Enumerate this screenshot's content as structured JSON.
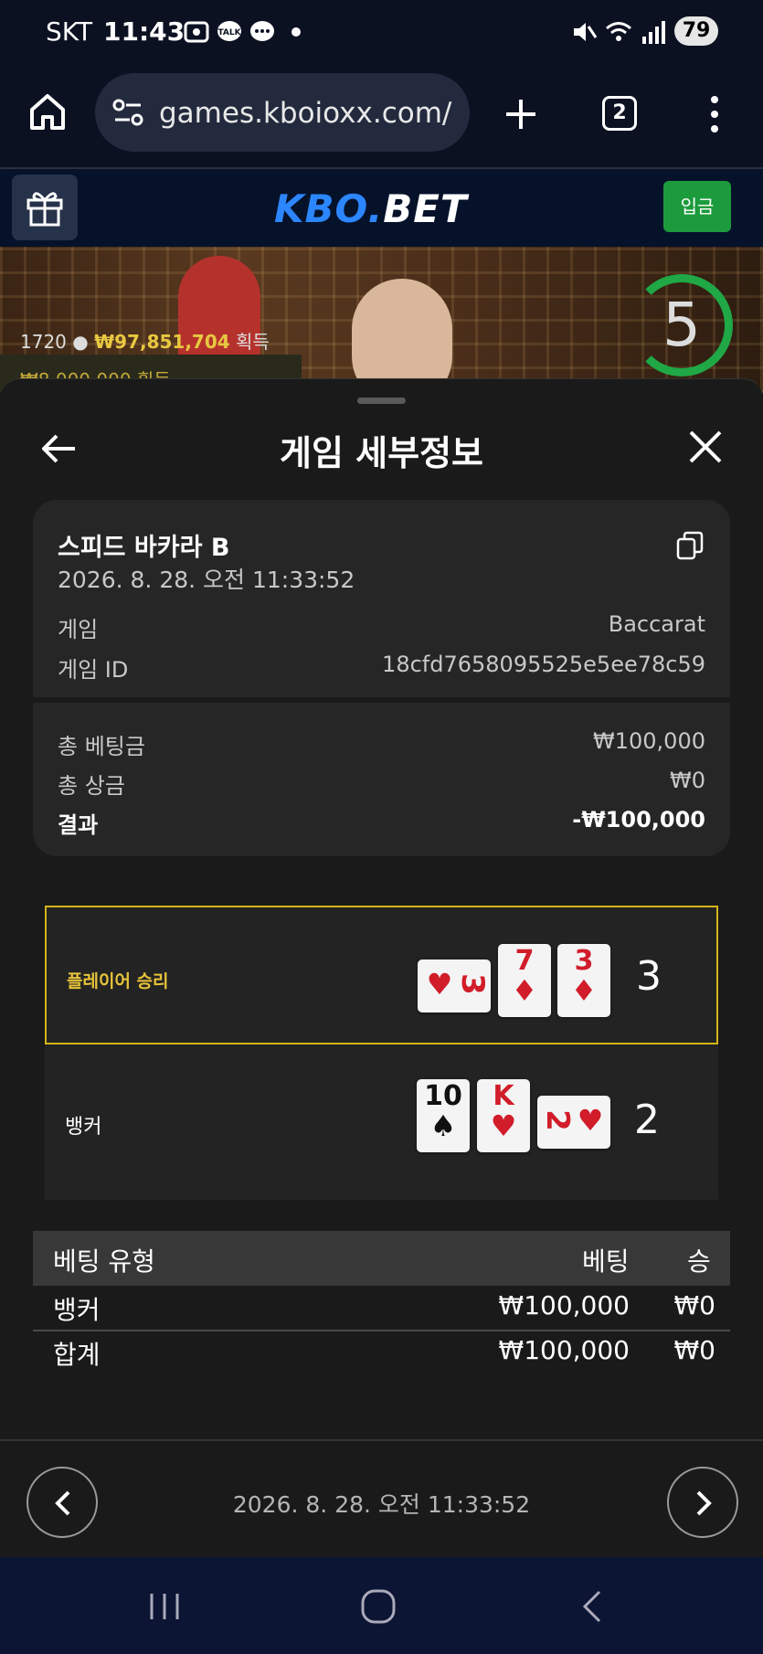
{
  "status_bar": {
    "carrier": "SKT",
    "time": "11:43",
    "battery": "79"
  },
  "browser": {
    "url": "games.kboioxx.com/",
    "tab_count": "2"
  },
  "site": {
    "logo_part1": "KBO.",
    "logo_part2": "BET",
    "deposit_label": "입금"
  },
  "banner": {
    "players": "1720",
    "winnings": "₩97,851,704",
    "winnings_suffix": "획득",
    "second_line": "₩8,000,000 획득",
    "countdown": "5"
  },
  "sheet": {
    "title": "게임 세부정보",
    "game_name": "스피드 바카라 B",
    "game_datetime": "2026. 8. 28. 오전 11:33:52",
    "rows": [
      {
        "label": "게임",
        "value": "Baccarat"
      },
      {
        "label": "게임 ID",
        "value": "18cfd7658095525e5ee78c59"
      }
    ],
    "totals": [
      {
        "label": "총 베팅금",
        "value": "₩100,000"
      },
      {
        "label": "총 상금",
        "value": "₩0"
      },
      {
        "label": "결과",
        "value": "-₩100,000"
      }
    ]
  },
  "result": {
    "player": {
      "label": "플레이어 승리",
      "score": "3",
      "cards": [
        {
          "rank": "3",
          "suit": "♥",
          "color": "red",
          "orientation": "sideways"
        },
        {
          "rank": "7",
          "suit": "♦",
          "color": "red",
          "orientation": "upright"
        },
        {
          "rank": "3",
          "suit": "♦",
          "color": "red",
          "orientation": "upright"
        }
      ]
    },
    "banker": {
      "label": "뱅커",
      "score": "2",
      "cards": [
        {
          "rank": "10",
          "suit": "♠",
          "color": "black",
          "orientation": "upright"
        },
        {
          "rank": "K",
          "suit": "♥",
          "color": "red",
          "orientation": "upright"
        },
        {
          "rank": "2",
          "suit": "♥",
          "color": "red",
          "orientation": "sideways"
        }
      ]
    }
  },
  "bets": {
    "headers": {
      "type": "베팅 유형",
      "bet": "베팅",
      "win": "승"
    },
    "rows": [
      {
        "type": "뱅커",
        "bet": "₩100,000",
        "win": "₩0"
      },
      {
        "type": "합계",
        "bet": "₩100,000",
        "win": "₩0"
      }
    ]
  },
  "footer": {
    "datetime": "2026. 8. 28. 오전 11:33:52"
  },
  "colors": {
    "accent_green": "#1fa845",
    "player_highlight": "#d4b418",
    "logo_blue": "#2c86ff"
  }
}
